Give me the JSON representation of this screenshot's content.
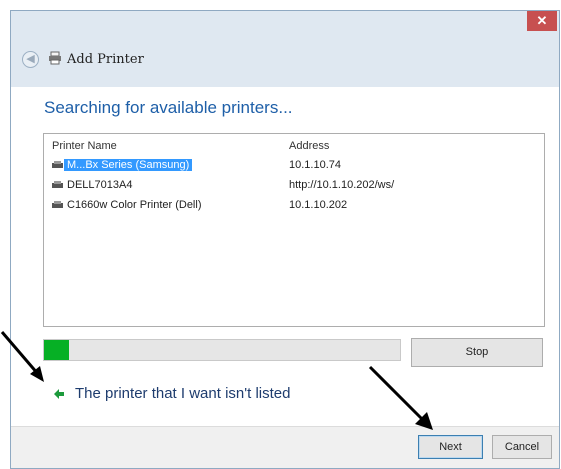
{
  "window": {
    "title": "Add Printer",
    "close_label": "✕",
    "back_label": "◀"
  },
  "main": {
    "heading": "Searching for available printers...",
    "columns": {
      "name": "Printer Name",
      "address": "Address"
    },
    "printers": [
      {
        "name": "M...Bx Series (Samsung)",
        "address": "10.1.10.74",
        "selected": true
      },
      {
        "name": "DELL7013A4",
        "address": "http://10.1.10.202/ws/",
        "selected": false
      },
      {
        "name": "C1660w Color Printer (Dell)",
        "address": "10.1.10.202",
        "selected": false
      }
    ],
    "progress_fraction": 0.07,
    "stop_label": "Stop",
    "not_listed_link": "The printer that I want isn't listed"
  },
  "footer": {
    "next_label": "Next",
    "cancel_label": "Cancel"
  },
  "icons": {
    "back": "back-arrow-icon",
    "printer": "printer-icon",
    "link_arrow": "green-arrow-icon",
    "annotation": "black-pointer-arrow-icon"
  },
  "colors": {
    "heading": "#1e5fa8",
    "selection": "#3399ff",
    "progress": "#06b025",
    "close": "#c75050",
    "titlebar": "#dfe8f1"
  }
}
